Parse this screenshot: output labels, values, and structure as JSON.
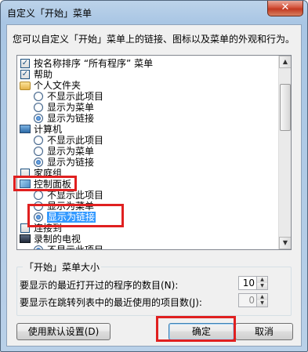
{
  "window": {
    "title": "自定义「开始」菜单",
    "close_glyph": "✕"
  },
  "description": "您可以自定义「开始」菜单上的链接、图标以及菜单的外观和行为。",
  "options": [
    {
      "kind": "checkbox",
      "label": "按名称排序 “所有程序” 菜单",
      "checked": true,
      "mark": "✓"
    },
    {
      "kind": "checkbox",
      "label": "帮助",
      "checked": true,
      "mark": "✓"
    },
    {
      "kind": "header",
      "icon": "folder-icon",
      "label": "个人文件夹"
    },
    {
      "kind": "radio",
      "label": "不显示此项目",
      "checked": false
    },
    {
      "kind": "radio",
      "label": "显示为菜单",
      "checked": false
    },
    {
      "kind": "radio",
      "label": "显示为链接",
      "checked": true
    },
    {
      "kind": "header",
      "icon": "computer-icon",
      "label": "计算机"
    },
    {
      "kind": "radio",
      "label": "不显示此项目",
      "checked": false
    },
    {
      "kind": "radio",
      "label": "显示为菜单",
      "checked": false
    },
    {
      "kind": "radio",
      "label": "显示为链接",
      "checked": true
    },
    {
      "kind": "checkbox",
      "label": "家庭组",
      "checked": false,
      "mark": ""
    },
    {
      "kind": "header",
      "icon": "control-panel-icon",
      "label": "控制面板"
    },
    {
      "kind": "radio",
      "label": "不显示此项目",
      "checked": false
    },
    {
      "kind": "radio",
      "label": "显示为菜单",
      "checked": false
    },
    {
      "kind": "radio",
      "label": "显示为链接",
      "checked": true,
      "selected": true
    },
    {
      "kind": "checkbox",
      "label": "连接到",
      "checked": false,
      "mark": ""
    },
    {
      "kind": "header",
      "icon": "recorded-tv-icon",
      "label": "录制的电视"
    },
    {
      "kind": "radio",
      "label": "不显示此项目",
      "checked": true
    }
  ],
  "scrollbar": {
    "up": "▲",
    "down": "▼"
  },
  "menu_size": {
    "title": "「开始」菜单大小",
    "recent_programs_label": "要显示的最近打开过的程序的数目(N):",
    "recent_programs_value": "10",
    "jump_list_label": "要显示在跳转列表中的最近使用的项目数(J):",
    "jump_list_value": "0",
    "spin_up": "▲",
    "spin_down": "▼"
  },
  "buttons": {
    "defaults": "使用默认设置(D)",
    "ok": "确定",
    "cancel": "取消"
  },
  "colors": {
    "annotation": "#e02020",
    "selection": "#3399ff"
  }
}
